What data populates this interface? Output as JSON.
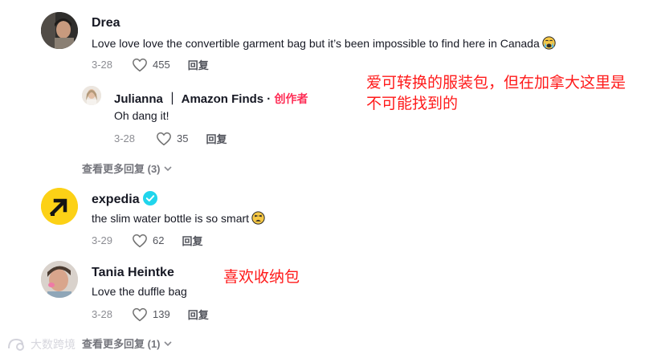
{
  "comments": [
    {
      "username": "Drea",
      "text": "Love love love the convertible garment bag but it’s been impossible to find here in Canada",
      "date": "3-28",
      "likes": "455",
      "reply_label": "回复",
      "replies": [
        {
          "username": "Julianna ｜ Amazon  Finds",
          "separator": " · ",
          "creator_badge": "创作者",
          "text": "Oh dang it!",
          "date": "3-28",
          "likes": "35",
          "reply_label": "回复"
        }
      ],
      "view_more_label": "查看更多回复 (3)"
    },
    {
      "username": "expedia",
      "verified": true,
      "text": "the slim water bottle is so smart",
      "date": "3-29",
      "likes": "62",
      "reply_label": "回复"
    },
    {
      "username": "Tania Heintke",
      "text": "Love the duffle bag",
      "date": "3-28",
      "likes": "139",
      "reply_label": "回复",
      "view_more_label": "查看更多回复 (1)"
    }
  ],
  "annotations": {
    "note_1": "爱可转换的服装包，但在加拿大这里是不可能找到的",
    "note_2": "喜欢收纳包",
    "color": "#ff1a1a"
  },
  "watermark": "大数跨境",
  "colors": {
    "creator_badge": "#fe2c55",
    "expedia_brand": "#fcd116",
    "verified": "#20d5ec"
  }
}
